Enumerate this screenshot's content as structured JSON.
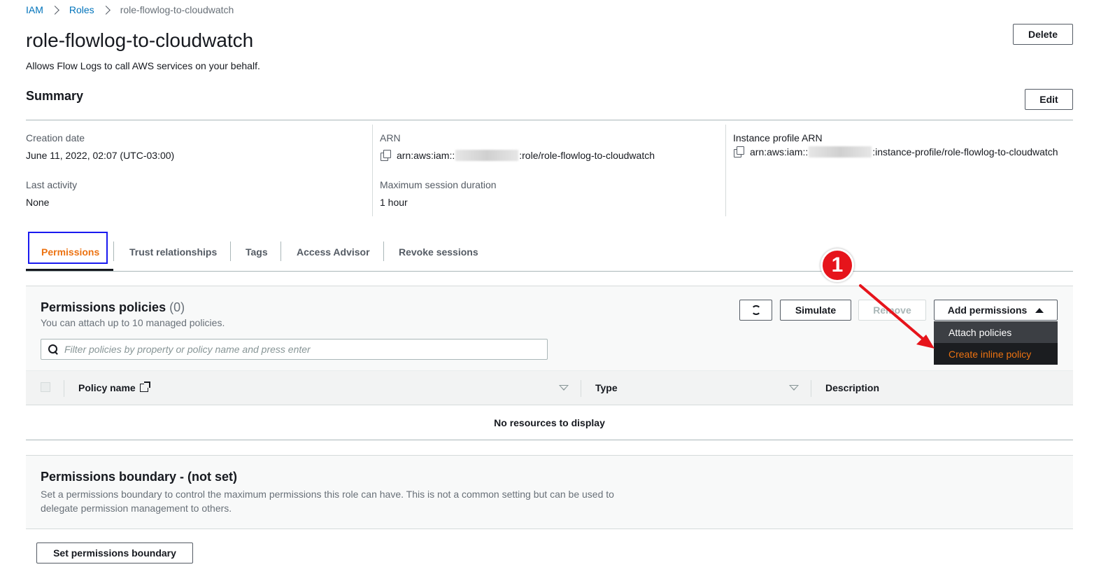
{
  "breadcrumb": {
    "items": [
      "IAM",
      "Roles"
    ],
    "current": "role-flowlog-to-cloudwatch"
  },
  "header": {
    "title": "role-flowlog-to-cloudwatch",
    "description": "Allows Flow Logs to call AWS services on your behalf.",
    "delete_label": "Delete"
  },
  "summary": {
    "title": "Summary",
    "edit_label": "Edit",
    "creation_date_label": "Creation date",
    "creation_date": "June 11, 2022, 02:07 (UTC-03:00)",
    "last_activity_label": "Last activity",
    "last_activity": "None",
    "arn_label": "ARN",
    "arn_prefix": "arn:aws:iam::",
    "arn_suffix": ":role/role-flowlog-to-cloudwatch",
    "max_session_label": "Maximum session duration",
    "max_session": "1 hour",
    "instance_profile_label": "Instance profile ARN",
    "instance_profile_prefix": "arn:aws:iam::",
    "instance_profile_suffix": ":instance-profile/role-flowlog-to-cloudwatch"
  },
  "tabs": [
    {
      "label": "Permissions",
      "active": true
    },
    {
      "label": "Trust relationships"
    },
    {
      "label": "Tags"
    },
    {
      "label": "Access Advisor"
    },
    {
      "label": "Revoke sessions"
    }
  ],
  "policies": {
    "title": "Permissions policies",
    "count": "(0)",
    "subtitle": "You can attach up to 10 managed policies.",
    "search_placeholder": "Filter policies by property or policy name and press enter",
    "simulate_label": "Simulate",
    "remove_label": "Remove",
    "add_permissions_label": "Add permissions",
    "dropdown": [
      "Attach policies",
      "Create inline policy"
    ],
    "columns": [
      "Policy name",
      "Type",
      "Description"
    ],
    "empty_text": "No resources to display"
  },
  "boundary": {
    "title": "Permissions boundary - (not set)",
    "description": "Set a permissions boundary to control the maximum permissions this role can have. This is not a common setting but can be used to delegate permission management to others.",
    "button_label": "Set permissions boundary"
  },
  "annotation": {
    "step": "1"
  },
  "colors": {
    "accent": "#ec7211",
    "link": "#0073bb",
    "highlight": "#1a1af0",
    "annotation": "#e6141b"
  },
  "icons": [
    "chevron-right-icon",
    "copy-icon",
    "refresh-icon",
    "search-icon",
    "caret-up-icon",
    "external-link-icon",
    "sort-caret-icon"
  ]
}
